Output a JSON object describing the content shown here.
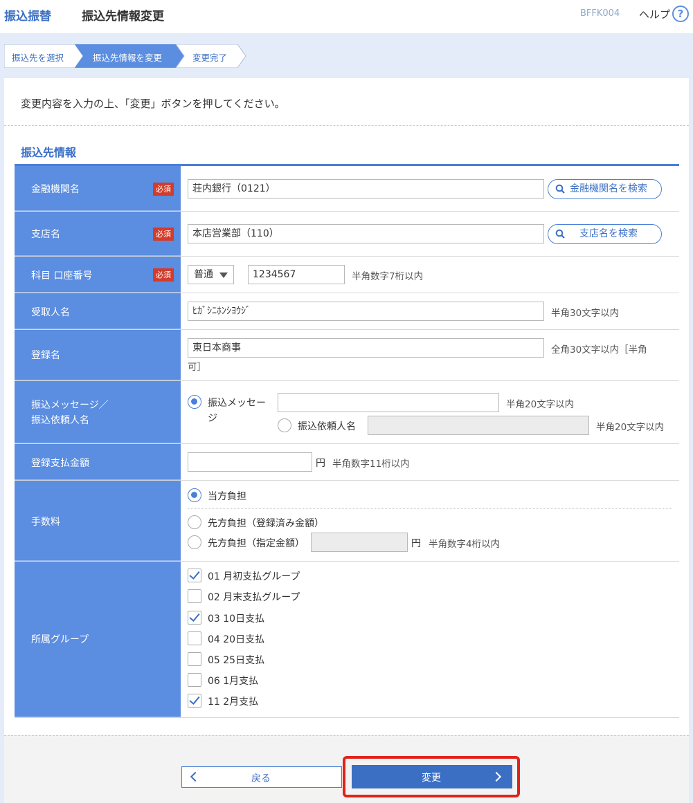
{
  "header": {
    "category": "振込振替",
    "title": "振込先情報変更",
    "screen_code": "BFFK004",
    "help_label": "ヘルプ",
    "help_icon": "?"
  },
  "steps": [
    {
      "label": "振込先を選択",
      "state": "done"
    },
    {
      "label": "振込先情報を変更",
      "state": "current"
    },
    {
      "label": "変更完了",
      "state": "todo"
    }
  ],
  "instruction": "変更内容を入力の上、「変更」ボタンを押してください。",
  "section_title": "振込先情報",
  "required_badge": "必須",
  "form": {
    "bank": {
      "label": "金融機関名",
      "value": "荘内銀行（0121）",
      "search_label": "金融機関名を検索"
    },
    "branch": {
      "label": "支店名",
      "value": "本店営業部（110）",
      "search_label": "支店名を検索"
    },
    "account": {
      "label": "科目 口座番号",
      "type_value": "普通",
      "number_value": "1234567",
      "hint": "半角数字7桁以内"
    },
    "payee": {
      "label": "受取人名",
      "value": "ﾋｶﾞｼﾆﾎﾝｼﾖｳｼﾞ",
      "hint": "半角30文字以内"
    },
    "reg_name": {
      "label": "登録名",
      "value": "東日本商事",
      "hint_line1": "全角30文字以内［半角",
      "hint_line2": "可］"
    },
    "message": {
      "label_line1": "振込メッセージ／",
      "label_line2": "振込依頼人名",
      "opt1_line1": "振込メッセー",
      "opt1_line2": "ジ",
      "opt1_value": "",
      "opt1_hint": "半角20文字以内",
      "opt2_label": "振込依頼人名",
      "opt2_value": "",
      "opt2_hint": "半角20文字以内",
      "selected": "opt1"
    },
    "amount": {
      "label": "登録支払金額",
      "value": "",
      "unit": "円",
      "hint": "半角数字11桁以内"
    },
    "fee": {
      "label": "手数料",
      "opt1": "当方負担",
      "opt2": "先方負担（登録済み金額）",
      "opt3": "先方負担（指定金額）",
      "opt3_value": "",
      "opt3_unit": "円",
      "opt3_hint": "半角数字4桁以内",
      "selected": "opt1"
    },
    "groups": {
      "label": "所属グループ",
      "items": [
        {
          "label": "01 月初支払グループ",
          "checked": true
        },
        {
          "label": "02 月末支払グループ",
          "checked": false
        },
        {
          "label": "03 10日支払",
          "checked": true
        },
        {
          "label": "04 20日支払",
          "checked": false
        },
        {
          "label": "05 25日支払",
          "checked": false
        },
        {
          "label": "06 1月支払",
          "checked": false
        },
        {
          "label": "11 2月支払",
          "checked": true
        }
      ]
    }
  },
  "buttons": {
    "back": "戻る",
    "change": "変更"
  },
  "colors": {
    "accent": "#3a6fc4",
    "label_bg": "#5b8de0",
    "highlight": "#e2221a",
    "required": "#d33b2a"
  }
}
